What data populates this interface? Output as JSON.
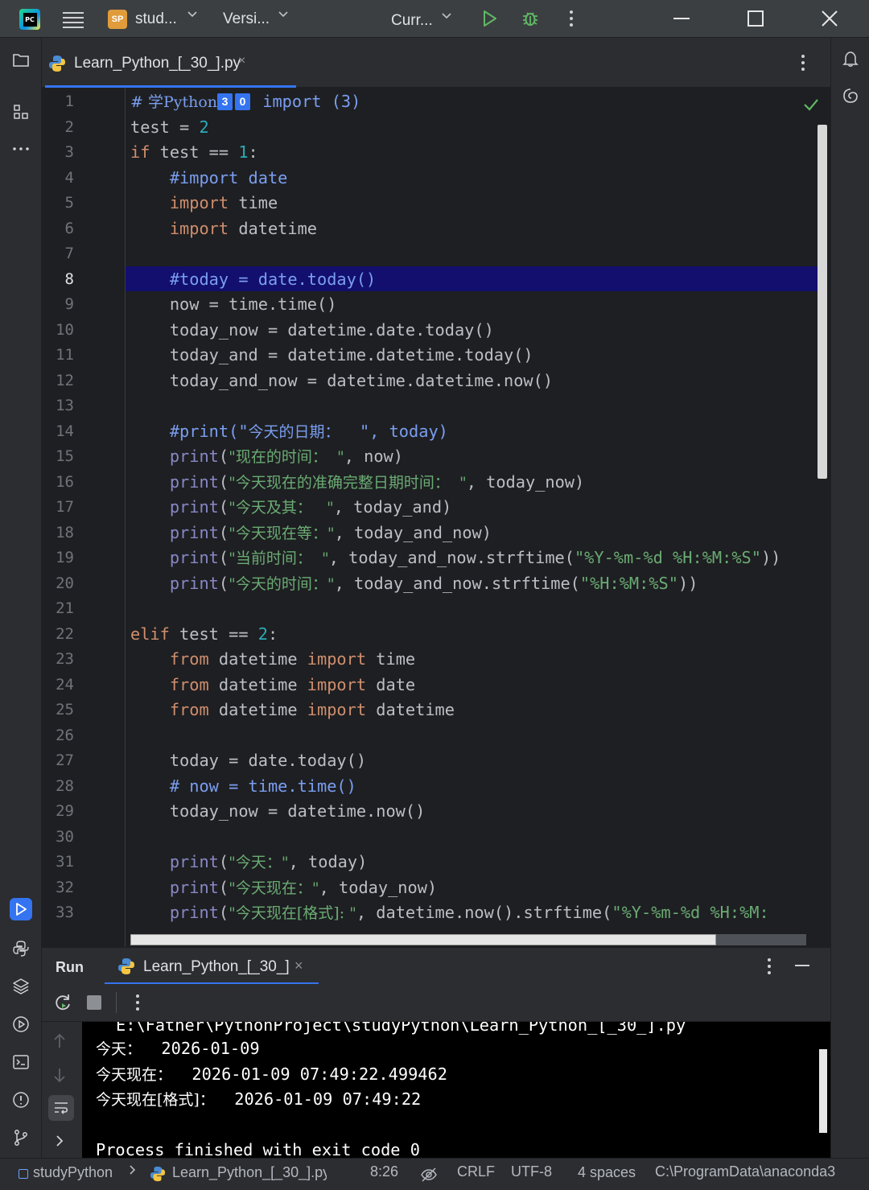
{
  "titlebar": {
    "project_badge": "SP",
    "project_name": "stud...",
    "vcs_label": "Versi...",
    "run_config": "Curr..."
  },
  "editor_tab": {
    "filename": "Learn_Python_[_30_].py",
    "close": "×"
  },
  "editor": {
    "line_numbers": [
      "1",
      "2",
      "3",
      "4",
      "5",
      "6",
      "7",
      "8",
      "9",
      "10",
      "11",
      "12",
      "13",
      "14",
      "15",
      "16",
      "17",
      "18",
      "19",
      "20",
      "21",
      "22",
      "23",
      "24",
      "25",
      "26",
      "27",
      "28",
      "29",
      "30",
      "31",
      "32",
      "33"
    ],
    "current_line": "8",
    "badge_a": "3",
    "badge_b": "0",
    "code": {
      "l1_a": "# 学Python",
      "l1_b": " import (3)",
      "l2_a": "test = ",
      "l2_b": "2",
      "l3_a": "if",
      "l3_b": " test == ",
      "l3_c": "1",
      "l3_d": ":",
      "l4": "    #import date",
      "l5_a": "    import",
      "l5_b": " time",
      "l6_a": "    import",
      "l6_b": " datetime",
      "l8": "    #today = date.today()",
      "l9": "    now = time.time()",
      "l10": "    today_now = datetime.date.today()",
      "l11": "    today_and = datetime.datetime.today()",
      "l12": "    today_and_now = datetime.datetime.now()",
      "l14_a": "    #print(\"",
      "l14_b": "今天的日期：",
      "l14_c": "  \", today)",
      "l15_a": "    print",
      "l15_b": "(",
      "l15_c": "\"现在的时间：  \"",
      "l15_d": ", now)",
      "l16_a": "    print",
      "l16_b": "(",
      "l16_c": "\"今天现在的准确完整日期时间：  \"",
      "l16_d": ", today_now)",
      "l17_a": "    print",
      "l17_b": "(",
      "l17_c": "\"今天及其：   \"",
      "l17_d": ", today_and)",
      "l18_a": "    print",
      "l18_b": "(",
      "l18_c": "\"今天现在等：\"",
      "l18_d": ", today_and_now)",
      "l19_a": "    print",
      "l19_b": "(",
      "l19_c": "\"当前时间：  \"",
      "l19_d": ", today_and_now.strftime(",
      "l19_e": "\"%Y-%m-%d %H:%M:%S\"",
      "l19_f": "))",
      "l20_a": "    print",
      "l20_b": "(",
      "l20_c": "\"今天的时间：\"",
      "l20_d": ", today_and_now.strftime(",
      "l20_e": "\"%H:%M:%S\"",
      "l20_f": "))",
      "l22_a": "elif",
      "l22_b": " test == ",
      "l22_c": "2",
      "l22_d": ":",
      "l23_a": "    from",
      "l23_b": " datetime ",
      "l23_c": "import",
      "l23_d": " time",
      "l24_a": "    from",
      "l24_b": " datetime ",
      "l24_c": "import",
      "l24_d": " date",
      "l25_a": "    from",
      "l25_b": " datetime ",
      "l25_c": "import",
      "l25_d": " datetime",
      "l27": "    today = date.today()",
      "l28": "    # now = time.time()",
      "l29": "    today_now = datetime.now()",
      "l31_a": "    print",
      "l31_b": "(",
      "l31_c": "\"今天：\"",
      "l31_d": ", today)",
      "l32_a": "    print",
      "l32_b": "(",
      "l32_c": "\"今天现在：\"",
      "l32_d": ", today_now)",
      "l33_a": "    print",
      "l33_b": "(",
      "l33_c": "\"今天现在[格式]: \"",
      "l33_d": ", datetime.now().strftime(",
      "l33_e": "\"%Y-%m-%d %H:%M:"
    }
  },
  "run_panel": {
    "title": "Run",
    "tab_label": "Learn_Python_[_30_]",
    "close": "×"
  },
  "console": {
    "path_line": "E:\\Father\\PythonProject\\studyPython\\Learn_Python_[_30_].py",
    "line1_label": "今天：",
    "line1_value": "  2026-01-09",
    "line2_label": "今天现在：",
    "line2_value": "  2026-01-09 07:49:22.499462",
    "line3_label": "今天现在[格式]：",
    "line3_value": "  2026-01-09 07:49:22",
    "exit_line": "Process finished with exit code 0"
  },
  "statusbar": {
    "project": "studyPython",
    "file": "Learn_Python_[_30_].py",
    "position": "8:26",
    "line_sep": "CRLF",
    "encoding": "UTF-8",
    "indent": "4 spaces",
    "interpreter": "C:\\ProgramData\\anaconda3"
  },
  "colors": {
    "accent": "#3574f0",
    "keyword": "#cf8e6d",
    "number": "#2aacb8",
    "comment": "#7a9ef0",
    "builtin": "#8888c6",
    "string": "#6aab73",
    "current_line_bg": "#120f6e"
  }
}
